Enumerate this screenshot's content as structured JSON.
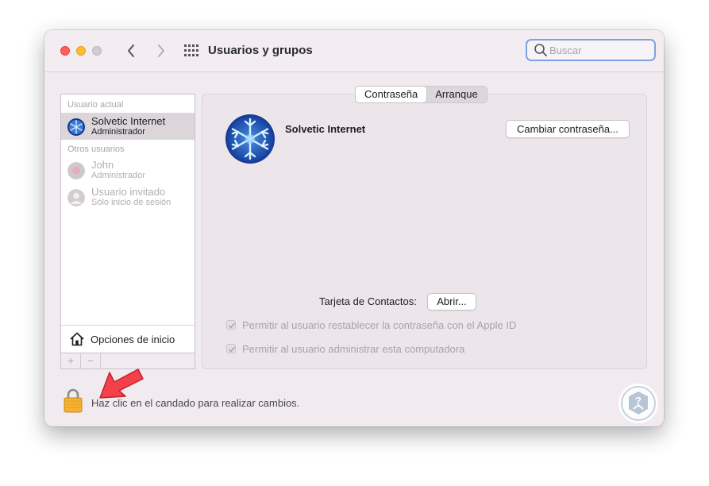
{
  "window": {
    "title": "Usuarios y grupos",
    "search": {
      "placeholder": "Buscar",
      "value": ""
    }
  },
  "sidebar": {
    "current_user_label": "Usuario actual",
    "current_user": {
      "name": "Solvetic Internet",
      "role": "Administrador"
    },
    "other_users_label": "Otros usuarios",
    "other_users": [
      {
        "name": "John",
        "role": "Administrador"
      },
      {
        "name": "Usuario invitado",
        "role": "Sólo inicio de sesión"
      }
    ],
    "login_options_label": "Opciones de inicio",
    "add_label": "+",
    "remove_label": "−"
  },
  "tabs": [
    {
      "label": "Contraseña",
      "active": true
    },
    {
      "label": "Arranque",
      "active": false
    }
  ],
  "main": {
    "user_full_name": "Solvetic Internet",
    "change_password_label": "Cambiar contraseña...",
    "contact_card_label": "Tarjeta de Contactos:",
    "open_label": "Abrir...",
    "checkboxes": [
      {
        "label": "Permitir al usuario restablecer la contraseña con el Apple ID",
        "checked": true,
        "enabled": false
      },
      {
        "label": "Permitir al usuario administrar esta computadora",
        "checked": true,
        "enabled": false
      }
    ]
  },
  "footer": {
    "lock_text": "Haz clic en el candado para realizar cambios."
  },
  "colors": {
    "accent": "#7ba2e4",
    "close": "#ff5f57",
    "minimize": "#febc2e",
    "annotation_arrow": "#f4404a"
  },
  "icons": [
    "back-icon",
    "forward-icon",
    "grid-icon",
    "search-icon",
    "home-icon",
    "lock-icon",
    "help-icon",
    "arrow-annotation"
  ]
}
